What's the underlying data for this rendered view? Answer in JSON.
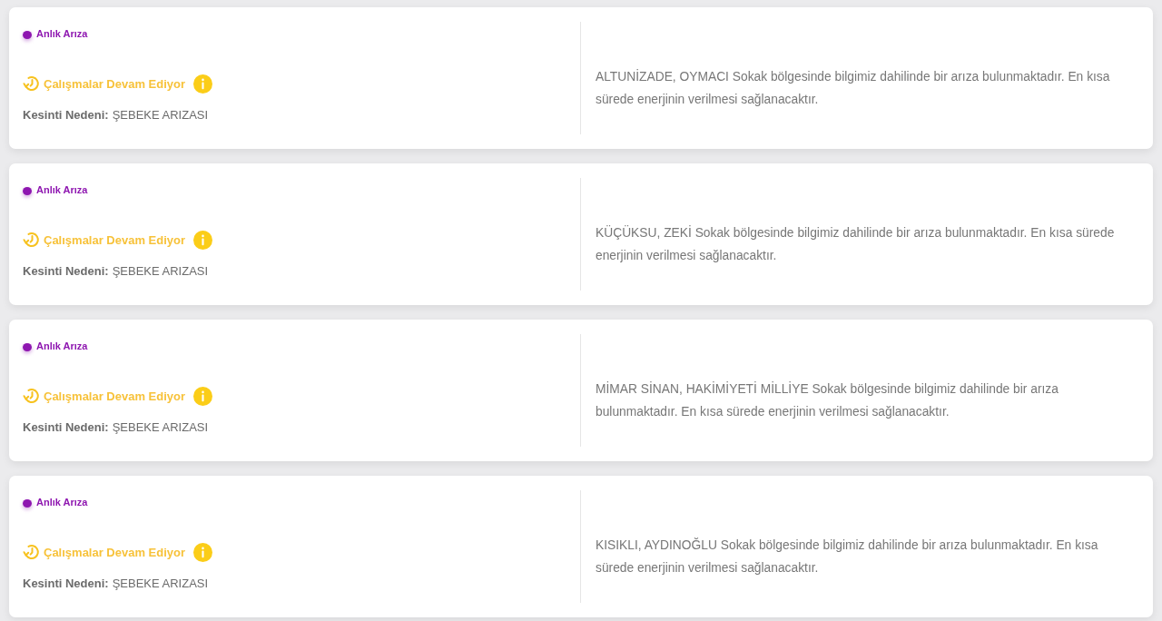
{
  "outages": [
    {
      "category": {
        "label": "Anlık Arıza",
        "color": "#8e16b0"
      },
      "status": {
        "label": "Çalışmalar Devam Ediyor"
      },
      "reason": {
        "label": "Kesinti Nedeni:",
        "value": "ŞEBEKE ARIZASI"
      },
      "description": "ALTUNİZADE, OYMACI Sokak bölgesinde bilgimiz dahilinde bir arıza bulunmaktadır. En kısa sürede enerjinin verilmesi sağlanacaktır."
    },
    {
      "category": {
        "label": "Anlık Arıza",
        "color": "#8e16b0"
      },
      "status": {
        "label": "Çalışmalar Devam Ediyor"
      },
      "reason": {
        "label": "Kesinti Nedeni:",
        "value": "ŞEBEKE ARIZASI"
      },
      "description": "KÜÇÜKSU, ZEKİ Sokak bölgesinde bilgimiz dahilinde bir arıza bulunmaktadır. En kısa sürede enerjinin verilmesi sağlanacaktır."
    },
    {
      "category": {
        "label": "Anlık Arıza",
        "color": "#8e16b0"
      },
      "status": {
        "label": "Çalışmalar Devam Ediyor"
      },
      "reason": {
        "label": "Kesinti Nedeni:",
        "value": "ŞEBEKE ARIZASI"
      },
      "description": "MİMAR SİNAN, HAKİMİYETİ MİLLİYE Sokak bölgesinde bilgimiz dahilinde bir arıza bulunmaktadır. En kısa sürede enerjinin verilmesi sağlanacaktır."
    },
    {
      "category": {
        "label": "Anlık Arıza",
        "color": "#8e16b0"
      },
      "status": {
        "label": "Çalışmalar Devam Ediyor"
      },
      "reason": {
        "label": "Kesinti Nedeni:",
        "value": "ŞEBEKE ARIZASI"
      },
      "description": "KISIKLI, AYDINOĞLU Sokak bölgesinde bilgimiz dahilinde bir arıza bulunmaktadır. En kısa sürede enerjinin verilmesi sağlanacaktır."
    }
  ]
}
